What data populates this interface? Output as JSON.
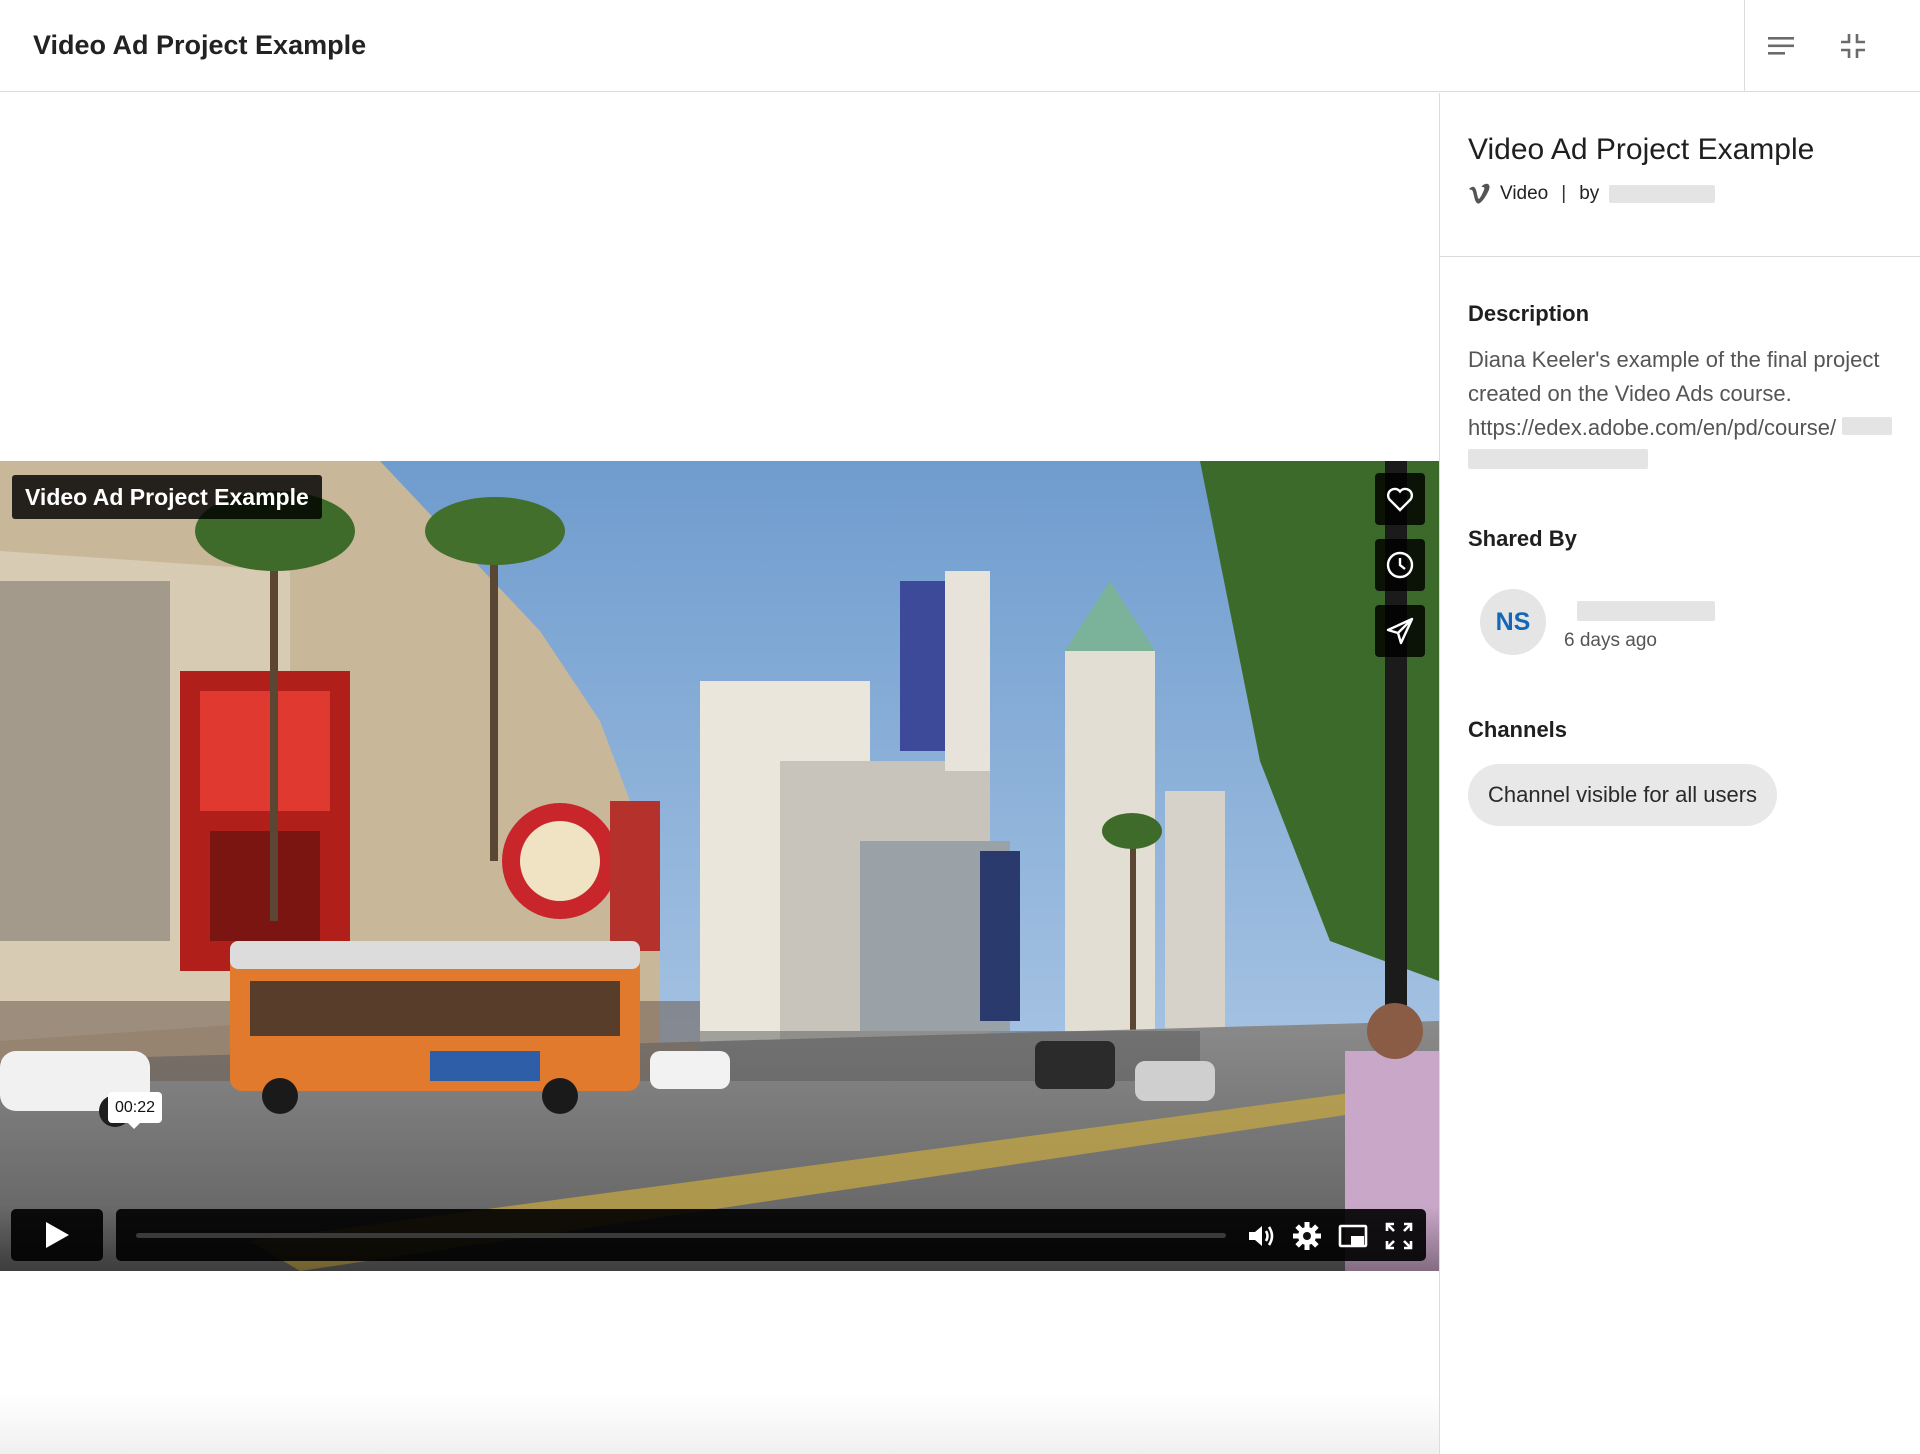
{
  "header": {
    "title": "Video Ad Project Example",
    "actions": [
      {
        "name": "menu-lines-icon"
      },
      {
        "name": "collapse-icon"
      }
    ]
  },
  "player": {
    "title": "Video Ad Project Example",
    "side_actions": [
      "heart-icon",
      "clock-icon",
      "send-icon"
    ],
    "time_tooltip": "00:22",
    "progress_fraction": 0.0,
    "controls": [
      "play-icon",
      "volume-icon",
      "settings-gear-icon",
      "picture-in-picture-icon",
      "fullscreen-icon"
    ]
  },
  "panel": {
    "title": "Video Ad Project Example",
    "source_label": "Video",
    "separator": "|",
    "by_label": "by",
    "description_heading": "Description",
    "description_text": "Diana Keeler's example of the final project created on the Video Ads course. https://edex.adobe.com/en/pd/course/",
    "shared_by_heading": "Shared By",
    "avatar_initials": "NS",
    "shared_time": "6 days ago",
    "channels_heading": "Channels",
    "channel_chip": "Channel visible for all users"
  },
  "colors": {
    "avatar_text": "#1466b8",
    "border": "#dcdcdc",
    "chip_bg": "#e8e8e8"
  }
}
